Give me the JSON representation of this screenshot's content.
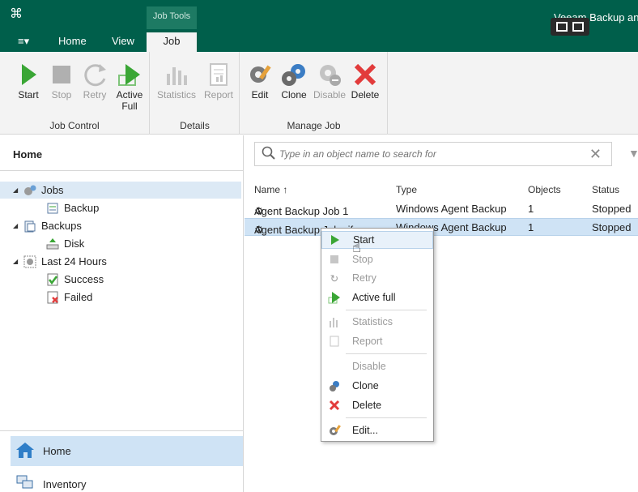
{
  "colors": {
    "brand": "#005f4b",
    "selection": "#cfe3f5",
    "start_green": "#3aa635",
    "delete_red": "#e23b3b"
  },
  "title_bar": {
    "title": "Veeam Backup and",
    "context_group": "Job Tools"
  },
  "ribbon_tabs": {
    "menu": "≡▾",
    "home": "Home",
    "view": "View",
    "job": "Job"
  },
  "ribbon": {
    "job_control": {
      "label": "Job Control",
      "start": "Start",
      "stop": "Stop",
      "retry": "Retry",
      "active_full": "Active Full"
    },
    "details": {
      "label": "Details",
      "statistics": "Statistics",
      "report": "Report"
    },
    "manage_job": {
      "label": "Manage Job",
      "edit": "Edit",
      "clone": "Clone",
      "disable": "Disable",
      "delete": "Delete"
    }
  },
  "sidebar": {
    "heading": "Home",
    "tree": [
      {
        "label": "Jobs",
        "icon": "gears-icon"
      },
      {
        "label": "Backup",
        "icon": "backup-job-icon"
      },
      {
        "label": "Backups",
        "icon": "backups-icon"
      },
      {
        "label": "Disk",
        "icon": "disk-icon"
      },
      {
        "label": "Last 24 Hours",
        "icon": "clock-icon"
      },
      {
        "label": "Success",
        "icon": "success-icon"
      },
      {
        "label": "Failed",
        "icon": "failed-icon"
      }
    ],
    "nav": {
      "home": "Home",
      "inventory": "Inventory"
    }
  },
  "search": {
    "placeholder": "Type in an object name to search for"
  },
  "grid": {
    "columns": {
      "name": "Name ↑",
      "type": "Type",
      "objects": "Objects",
      "status": "Status"
    },
    "rows": [
      {
        "name": "Agent Backup Job 1",
        "type": "Windows Agent Backup",
        "objects": "1",
        "status": "Stopped"
      },
      {
        "name": "Agent Backup Job cifs",
        "type": "Windows Agent Backup",
        "objects": "1",
        "status": "Stopped"
      }
    ]
  },
  "context_menu": {
    "start": "Start",
    "stop": "Stop",
    "retry": "Retry",
    "active_full": "Active full",
    "statistics": "Statistics",
    "report": "Report",
    "disable": "Disable",
    "clone": "Clone",
    "delete": "Delete",
    "edit": "Edit..."
  }
}
